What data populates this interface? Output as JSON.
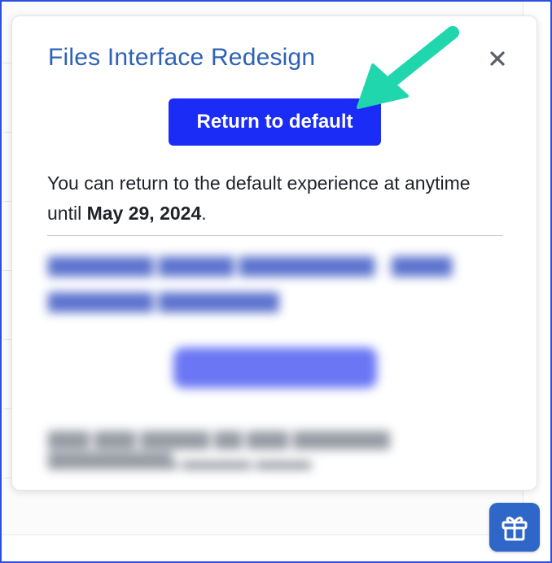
{
  "dialog": {
    "title": "Files Interface Redesign",
    "close_icon": "close-icon",
    "primary_button_label": "Return to default",
    "description_prefix": "You can return to the default experience at anytime until ",
    "description_date": "May 29, 2024",
    "description_suffix": "."
  },
  "launcher": {
    "icon": "gift-icon"
  },
  "colors": {
    "title": "#2e62b6",
    "primary_button": "#1a2cf5",
    "annotation_arrow": "#1fd6ad",
    "gift_button": "#2f67c9",
    "frame_border": "#2b4fe0"
  }
}
